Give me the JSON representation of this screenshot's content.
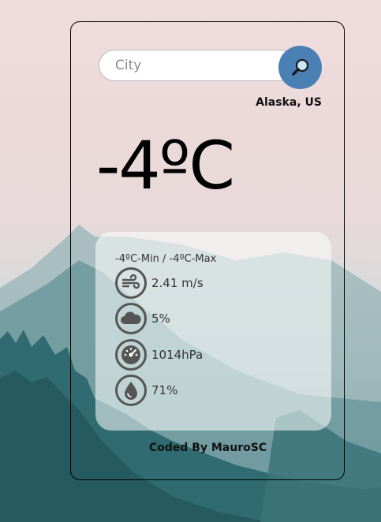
{
  "search": {
    "placeholder": "City",
    "value": ""
  },
  "location": "Alaska, US",
  "temperature": "-4ºC",
  "details": {
    "minmax": "-4ºC-Min / -4ºC-Max",
    "wind": "2.41 m/s",
    "clouds": "5%",
    "pressure": "1014hPa",
    "humidity": "71%"
  },
  "footer": "Coded By MauroSC",
  "colors": {
    "accent": "#4a80b3",
    "icon": "#555555"
  },
  "icons": {
    "search": "magnifier-icon",
    "wind": "wind-icon",
    "clouds": "cloud-icon",
    "pressure": "gauge-icon",
    "humidity": "droplet-icon"
  }
}
